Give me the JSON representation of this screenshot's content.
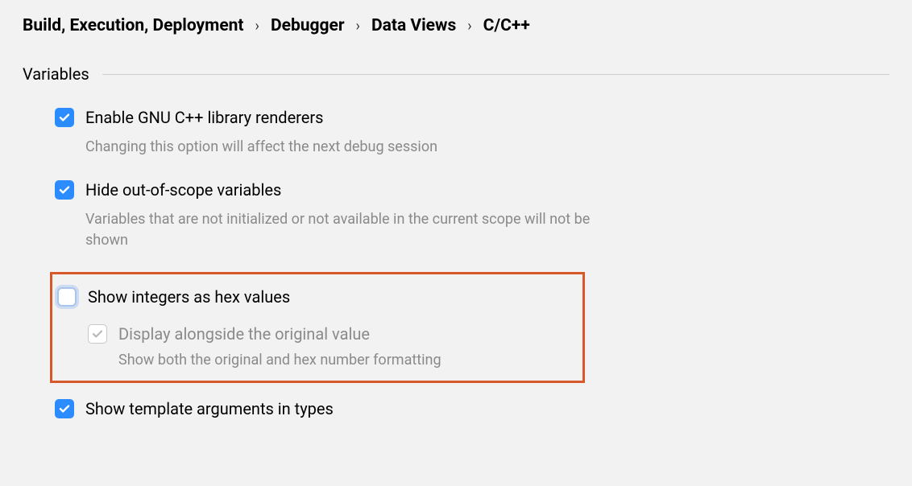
{
  "breadcrumb": {
    "items": [
      "Build, Execution, Deployment",
      "Debugger",
      "Data Views",
      "C/C++"
    ]
  },
  "section": {
    "title": "Variables"
  },
  "options": {
    "gnu_renderers": {
      "label": "Enable GNU C++ library renderers",
      "desc": "Changing this option will affect the next debug session"
    },
    "hide_out_of_scope": {
      "label": "Hide out-of-scope variables",
      "desc": "Variables that are not initialized or not available in the current scope will not be shown"
    },
    "show_hex": {
      "label": "Show integers as hex values"
    },
    "display_alongside": {
      "label": "Display alongside the original value",
      "desc": "Show both the original and hex number formatting"
    },
    "show_template_args": {
      "label": "Show template arguments in types"
    }
  }
}
